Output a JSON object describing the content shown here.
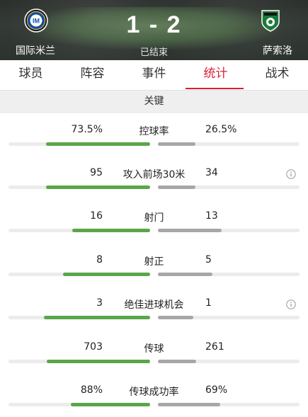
{
  "match": {
    "home_team": "国际米兰",
    "away_team": "萨索洛",
    "score": "1 - 2",
    "status": "已结束",
    "home_logo_icon": "inter-milan-crest-icon",
    "away_logo_icon": "sassuolo-crest-icon"
  },
  "tabs": [
    {
      "label": "球员",
      "active": false
    },
    {
      "label": "阵容",
      "active": false
    },
    {
      "label": "事件",
      "active": false
    },
    {
      "label": "统计",
      "active": true
    },
    {
      "label": "战术",
      "active": false
    }
  ],
  "section_title": "关键",
  "colors": {
    "accent": "#d81e34",
    "home_bar": "#5aa64a",
    "away_bar": "#a7a7a7",
    "track": "#ececec"
  },
  "stats": [
    {
      "label": "控球率",
      "home": "73.5%",
      "away": "26.5%",
      "home_share": 0.735,
      "away_share": 0.265,
      "info": false
    },
    {
      "label": "攻入前场30米",
      "home": "95",
      "away": "34",
      "home_share": 0.736,
      "away_share": 0.264,
      "info": true
    },
    {
      "label": "射门",
      "home": "16",
      "away": "13",
      "home_share": 0.552,
      "away_share": 0.448,
      "info": false
    },
    {
      "label": "射正",
      "home": "8",
      "away": "5",
      "home_share": 0.615,
      "away_share": 0.385,
      "info": false
    },
    {
      "label": "绝佳进球机会",
      "home": "3",
      "away": "1",
      "home_share": 0.75,
      "away_share": 0.25,
      "info": true
    },
    {
      "label": "传球",
      "home": "703",
      "away": "261",
      "home_share": 0.729,
      "away_share": 0.271,
      "info": false
    },
    {
      "label": "传球成功率",
      "home": "88%",
      "away": "69%",
      "home_share": 0.56,
      "away_share": 0.44,
      "info": false
    }
  ]
}
